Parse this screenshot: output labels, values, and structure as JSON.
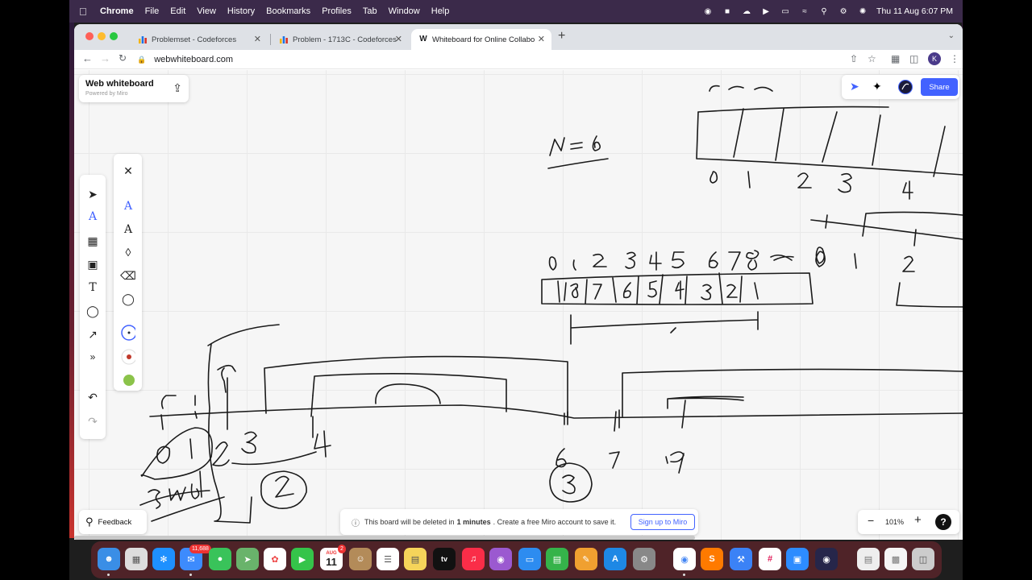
{
  "menubar": {
    "app": "Chrome",
    "menus": [
      "File",
      "Edit",
      "View",
      "History",
      "Bookmarks",
      "Profiles",
      "Tab",
      "Window",
      "Help"
    ],
    "datetime": "Thu 11 Aug  6:07 PM"
  },
  "browser": {
    "tabs": [
      {
        "title": "Problemset - Codeforces"
      },
      {
        "title": "Problem - 1713C - Codeforces"
      },
      {
        "title": "Whiteboard for Online Collabo"
      }
    ],
    "url": "webwhiteboard.com",
    "profile_initial": "K"
  },
  "board": {
    "title": "Web whiteboard",
    "subtitle": "Powered by Miro",
    "share_label": "Share",
    "feedback_label": "Feedback",
    "notice_prefix": "This board will be deleted in",
    "notice_time": "1 minutes",
    "notice_suffix": ". Create a free Miro account to save it.",
    "signup_label": "Sign up to Miro",
    "zoom": "101%",
    "help": "?"
  },
  "drawing": {
    "stroke_color": "#1a1a1a"
  },
  "pen_colors": [
    "#1f2937",
    "#c0392b",
    "#8bc34a"
  ],
  "dock": {
    "mail_badge": "11,688",
    "calendar_month": "AUG",
    "calendar_day": "11",
    "calendar_badge": "2",
    "tv_label": "tv"
  }
}
